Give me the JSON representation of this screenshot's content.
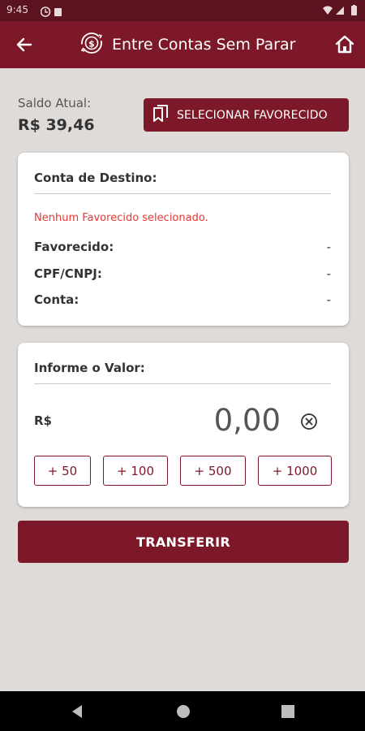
{
  "status_bar": {
    "time": "9:45"
  },
  "app_bar": {
    "title": "Entre Contas Sem Parar",
    "accent_color": "#7d1828"
  },
  "balance": {
    "label": "Saldo Atual:",
    "value": "R$ 39,46"
  },
  "select_favorite_button": {
    "label": "SELECIONAR FAVORECIDO"
  },
  "destination": {
    "title": "Conta de Destino:",
    "empty_message": "Nenhum Favorecido selecionado.",
    "rows": [
      {
        "label": "Favorecido:",
        "value": "-"
      },
      {
        "label": "CPF/CNPJ:",
        "value": "-"
      },
      {
        "label": "Conta:",
        "value": "-"
      }
    ]
  },
  "value_section": {
    "title": "Informe o Valor:",
    "currency": "R$",
    "amount": "0,00",
    "quick_amounts": [
      "+ 50",
      "+ 100",
      "+ 500",
      "+ 1000"
    ]
  },
  "transfer_button": {
    "label": "TRANSFERIR"
  }
}
